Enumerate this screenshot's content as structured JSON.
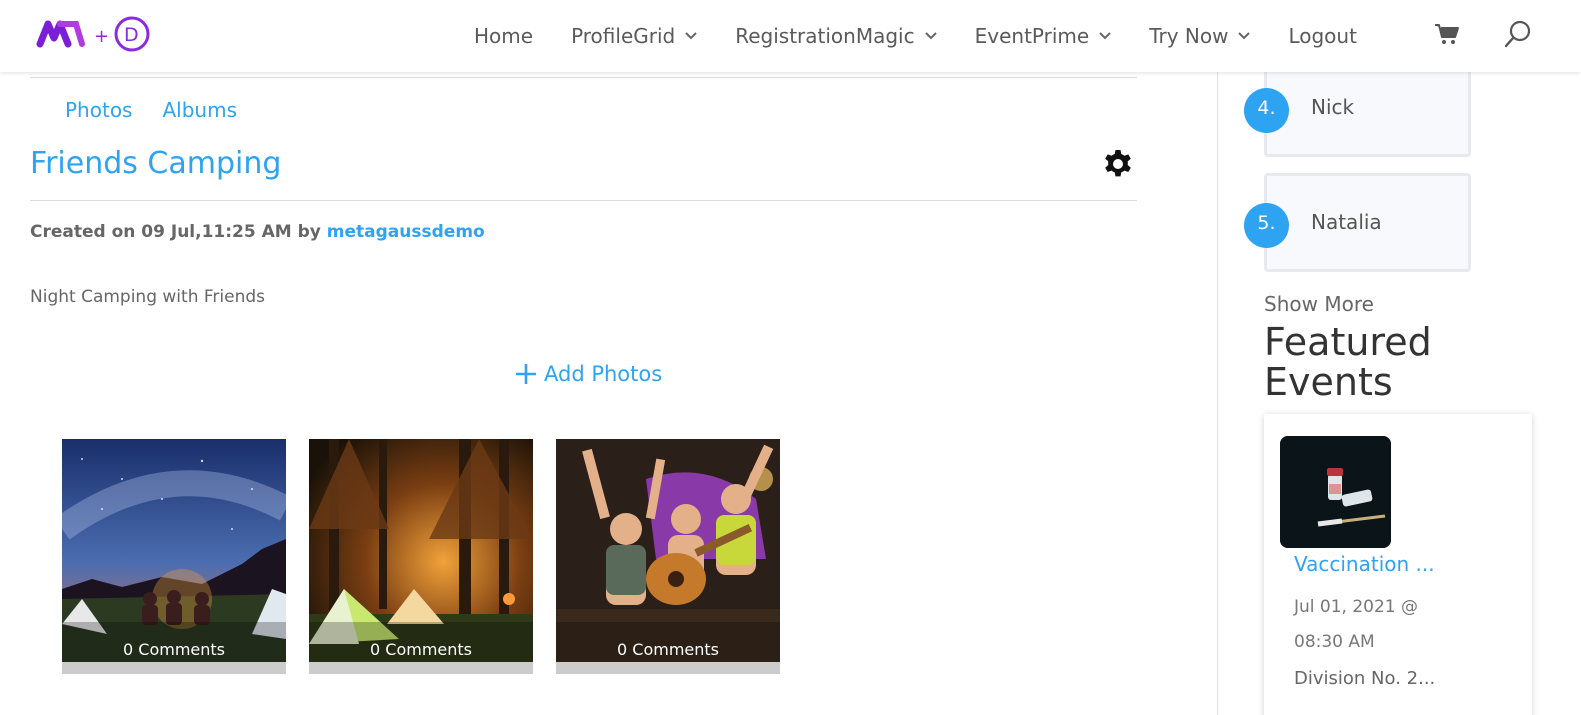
{
  "header": {
    "nav": [
      {
        "label": "Home",
        "has_dropdown": false
      },
      {
        "label": "ProfileGrid",
        "has_dropdown": true
      },
      {
        "label": "RegistrationMagic",
        "has_dropdown": true
      },
      {
        "label": "EventPrime",
        "has_dropdown": true
      },
      {
        "label": "Try Now",
        "has_dropdown": true
      },
      {
        "label": "Logout",
        "has_dropdown": false
      }
    ],
    "logo_text": "M+D"
  },
  "tabs": [
    "Photos",
    "Albums"
  ],
  "album": {
    "title": "Friends Camping",
    "created_prefix": "Created on 09 Jul,11:25 AM by ",
    "author": "metagaussdemo",
    "description": "Night Camping with Friends",
    "add_photos_label": "Add Photos"
  },
  "photos": [
    {
      "comments": "0 Comments"
    },
    {
      "comments": "0 Comments"
    },
    {
      "comments": "0 Comments"
    }
  ],
  "sidebar": {
    "members": [
      {
        "rank": "4.",
        "name": "Nick"
      },
      {
        "rank": "5.",
        "name": "Natalia"
      }
    ],
    "show_more": "Show More",
    "featured_heading": "Featured Events",
    "event": {
      "title": "Vaccination ...",
      "date": "Jul 01, 2021 @ 08:30 AM",
      "location": "Division No. 2..."
    }
  },
  "colors": {
    "accent": "#2ea3f2",
    "logo_purple": "#8a2be2"
  }
}
